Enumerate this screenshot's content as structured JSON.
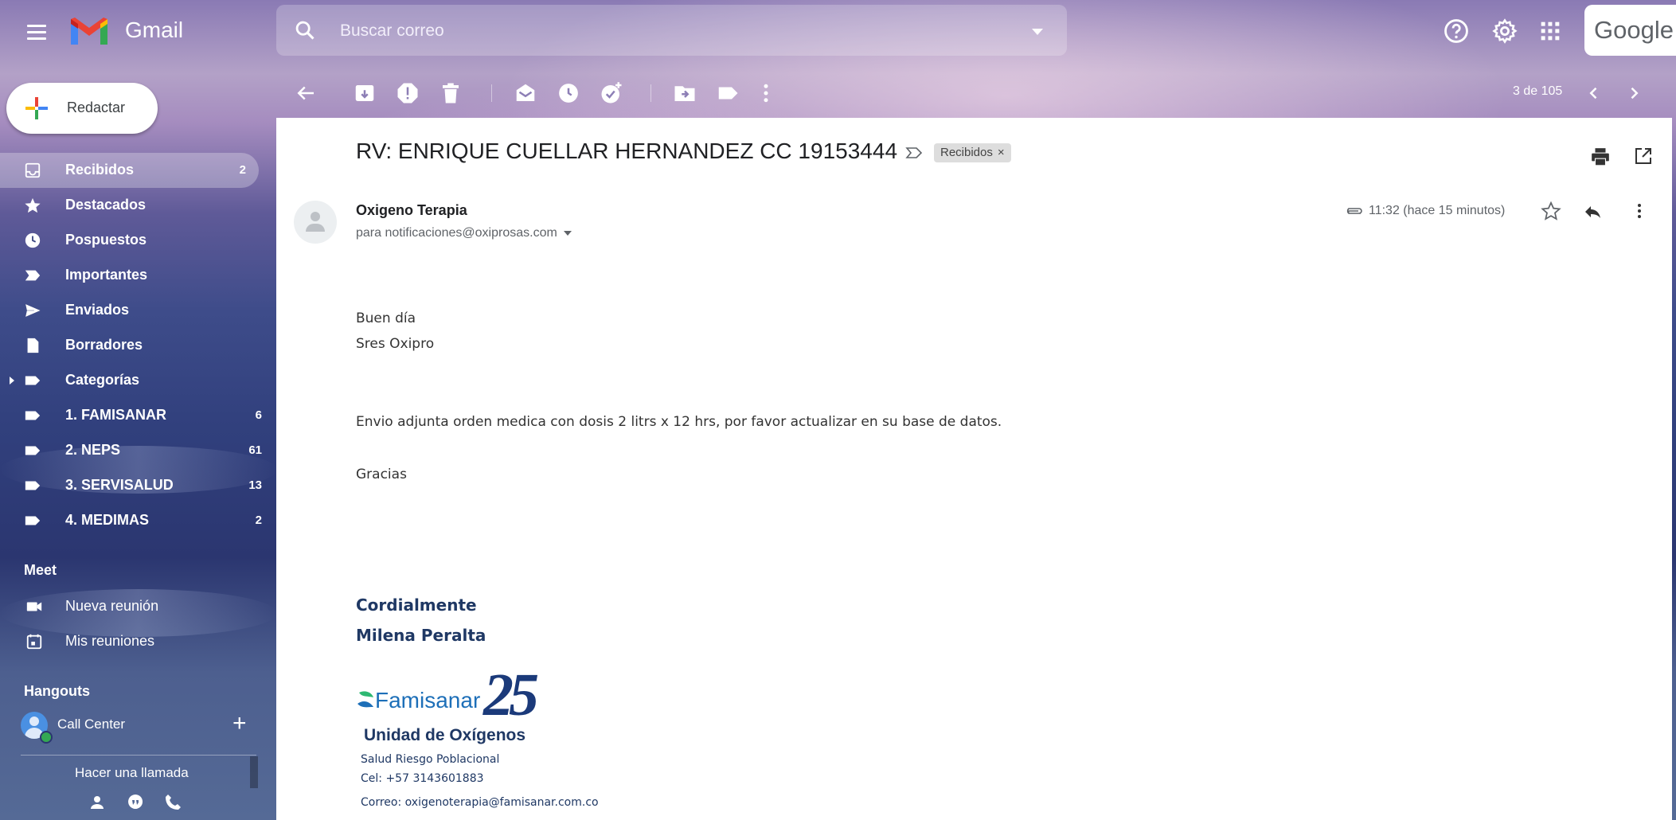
{
  "topbar": {
    "app_name": "Gmail",
    "search_placeholder": "Buscar correo",
    "google_text": "Google"
  },
  "sidebar": {
    "compose_label": "Redactar",
    "items": [
      {
        "label": "Recibidos",
        "count": "2",
        "icon": "inbox-icon"
      },
      {
        "label": "Destacados",
        "count": "",
        "icon": "star-icon"
      },
      {
        "label": "Pospuestos",
        "count": "",
        "icon": "clock-icon"
      },
      {
        "label": "Importantes",
        "count": "",
        "icon": "important-icon"
      },
      {
        "label": "Enviados",
        "count": "",
        "icon": "send-icon"
      },
      {
        "label": "Borradores",
        "count": "",
        "icon": "draft-icon"
      },
      {
        "label": "Categorías",
        "count": "",
        "icon": "label-icon"
      },
      {
        "label": "1. FAMISANAR",
        "count": "6",
        "icon": "label-icon"
      },
      {
        "label": "2. NEPS",
        "count": "61",
        "icon": "label-icon"
      },
      {
        "label": "3. SERVISALUD",
        "count": "13",
        "icon": "label-icon"
      },
      {
        "label": "4. MEDIMAS",
        "count": "2",
        "icon": "label-icon"
      }
    ],
    "meet_title": "Meet",
    "meet_items": [
      "Nueva reunión",
      "Mis reuniones"
    ],
    "hangouts_title": "Hangouts",
    "hangouts_user": "Call Center",
    "call_link": "Hacer una llamada"
  },
  "toolbar": {
    "pager": "3 de 105"
  },
  "email": {
    "subject": "RV: ENRIQUE CUELLAR HERNANDEZ CC 19153444",
    "label_chip": "Recibidos",
    "label_chip_close": "×",
    "sender": "Oxigeno Terapia",
    "recipient": "para notificaciones@oxiprosas.com",
    "time": "11:32 (hace 15 minutos)",
    "body": [
      "Buen día",
      "Sres Oxipro",
      "Envio adjunta orden medica con dosis 2 litrs x 12 hrs, por favor actualizar en su base de datos.",
      "Gracias"
    ],
    "signature": {
      "closing": "Cordialmente",
      "name": "Milena Peralta",
      "logo_brand": "Famisanar",
      "logo_number": "25",
      "unit": "Unidad de Oxígenos",
      "dept": "Salud Riesgo Poblacional",
      "phone": "Cel: +57 3143601883",
      "mail": "Correo: oxigenoterapia@famisanar.com.co"
    }
  },
  "colors": {
    "accent_red": "#ea4335",
    "accent_blue": "#4285f4",
    "accent_green": "#34a853",
    "accent_yellow": "#fbbc05",
    "signature_blue": "#1f3864"
  }
}
